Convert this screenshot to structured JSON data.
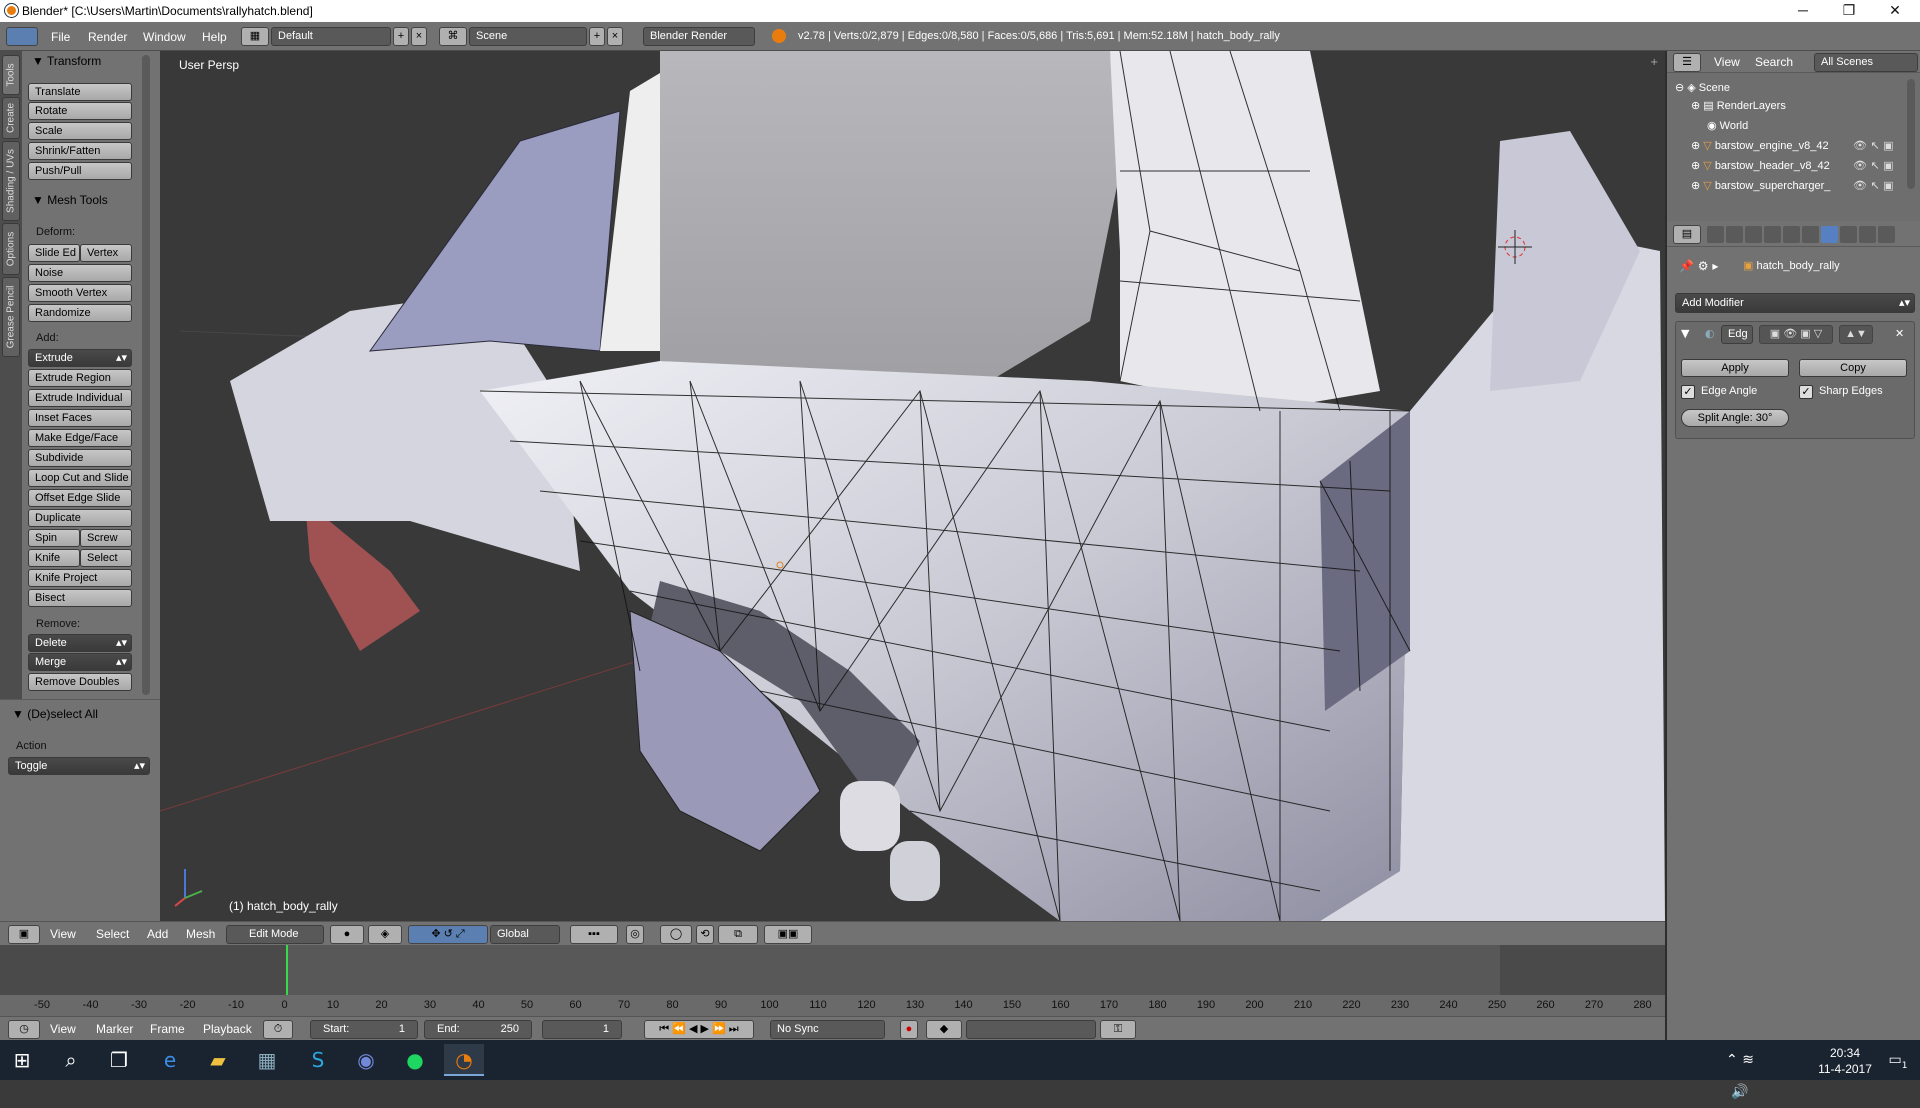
{
  "window": {
    "title": "Blender* [C:\\Users\\Martin\\Documents\\rallyhatch.blend]",
    "minimize": "─",
    "maximize": "❐",
    "close": "✕"
  },
  "info_header": {
    "menus": [
      "File",
      "Render",
      "Window",
      "Help"
    ],
    "layout": "Default",
    "scene": "Scene",
    "engine": "Blender Render",
    "stats": "v2.78 | Verts:0/2,879 | Edges:0/8,580 | Faces:0/5,686 | Tris:5,691 | Mem:52.18M | hatch_body_rally"
  },
  "left_tabs": [
    "Tools",
    "Create",
    "Shading / UVs",
    "Options",
    "Grease Pencil"
  ],
  "toolshelf": {
    "transform_header": "Transform",
    "transform": [
      "Translate",
      "Rotate",
      "Scale",
      "Shrink/Fatten",
      "Push/Pull"
    ],
    "mesh_tools_header": "Mesh Tools",
    "deform_label": "Deform:",
    "slide_edge": "Slide Ed",
    "vertex": "Vertex",
    "noise": "Noise",
    "smooth_vertex": "Smooth Vertex",
    "randomize": "Randomize",
    "add_label": "Add:",
    "extrude": "Extrude",
    "add_tools": [
      "Extrude Region",
      "Extrude Individual",
      "Inset Faces",
      "Make Edge/Face",
      "Subdivide",
      "Loop Cut and Slide",
      "Offset Edge Slide",
      "Duplicate"
    ],
    "spin": "Spin",
    "screw": "Screw",
    "knife": "Knife",
    "select": "Select",
    "knife_project": "Knife Project",
    "bisect": "Bisect",
    "remove_label": "Remove:",
    "delete": "Delete",
    "merge": "Merge",
    "remove_doubles": "Remove Doubles",
    "deselect_header": "(De)select All",
    "action_label": "Action",
    "action_value": "Toggle"
  },
  "viewport": {
    "view_label": "User Persp",
    "object_label": "(1) hatch_body_rally"
  },
  "view3d_header": {
    "menus": [
      "View",
      "Select",
      "Add",
      "Mesh"
    ],
    "mode": "Edit Mode",
    "orientation": "Global"
  },
  "timeline": {
    "ticks": [
      "-50",
      "-40",
      "-30",
      "-20",
      "-10",
      "0",
      "10",
      "20",
      "30",
      "40",
      "50",
      "60",
      "70",
      "80",
      "90",
      "100",
      "110",
      "120",
      "130",
      "140",
      "150",
      "160",
      "170",
      "180",
      "190",
      "200",
      "210",
      "220",
      "230",
      "240",
      "250",
      "260",
      "270",
      "280"
    ],
    "menus": [
      "View",
      "Marker",
      "Frame",
      "Playback"
    ],
    "start_label": "Start:",
    "start_value": "1",
    "end_label": "End:",
    "end_value": "250",
    "current": "1",
    "sync": "No Sync"
  },
  "outliner": {
    "menus": [
      "View",
      "Search"
    ],
    "filter": "All Scenes",
    "items": [
      "Scene",
      "RenderLayers",
      "World",
      "barstow_engine_v8_42",
      "barstow_header_v8_42",
      "barstow_supercharger_"
    ]
  },
  "properties": {
    "object_name": "hatch_body_rally",
    "add_modifier": "Add Modifier",
    "modifier_name": "Edg",
    "apply": "Apply",
    "copy": "Copy",
    "edge_angle": "Edge Angle",
    "sharp_edges": "Sharp Edges",
    "split_angle": "Split Angle: 30°"
  },
  "taskbar": {
    "time": "20:34",
    "date": "11-4-2017",
    "notification_count": "1"
  }
}
